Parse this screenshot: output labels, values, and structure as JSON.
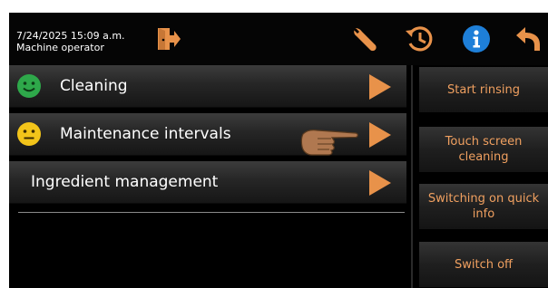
{
  "header": {
    "datetime": "7/24/2025 15:09 a.m.",
    "user_role": "Machine operator",
    "icons": [
      "logout-icon",
      "wrench-icon",
      "history-icon",
      "info-icon",
      "back-icon"
    ]
  },
  "menu": [
    {
      "label": "Cleaning",
      "status": "green-smiley"
    },
    {
      "label": "Maintenance intervals",
      "status": "yellow-smiley"
    },
    {
      "label": "Ingredient management",
      "status": "none"
    }
  ],
  "actions": [
    "Start rinsing",
    "Touch screen cleaning",
    "Switching on quick info",
    "Switch off"
  ],
  "colors": {
    "accent_orange": "#e8924a",
    "button_text": "#f0a060",
    "info_blue": "#1e7fd8",
    "smiley_green": "#2ea84a",
    "smiley_yellow": "#f2c41a"
  }
}
